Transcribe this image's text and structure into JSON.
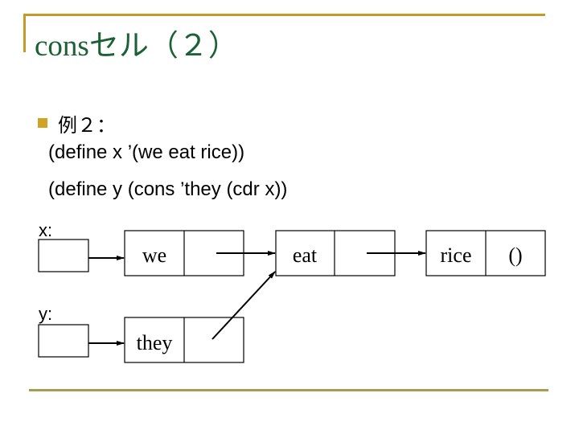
{
  "slide": {
    "title": "consセル（２）",
    "accent_color": "#c49a2a",
    "title_color": "#1a6236",
    "bullet": {
      "heading": "例２：",
      "lines": [
        "(define x ’(we eat rice))",
        "(define y (cons ’they (cdr x))"
      ]
    }
  },
  "diagram": {
    "variables": [
      {
        "name": "x:",
        "points_to": "we"
      },
      {
        "name": "y:",
        "points_to": "they"
      }
    ],
    "cells": [
      {
        "car": "we",
        "cdr": "→ eat"
      },
      {
        "car": "eat",
        "cdr": "→ rice"
      },
      {
        "car": "rice",
        "cdr": "()"
      },
      {
        "car": "they",
        "cdr": "→ eat"
      }
    ]
  }
}
